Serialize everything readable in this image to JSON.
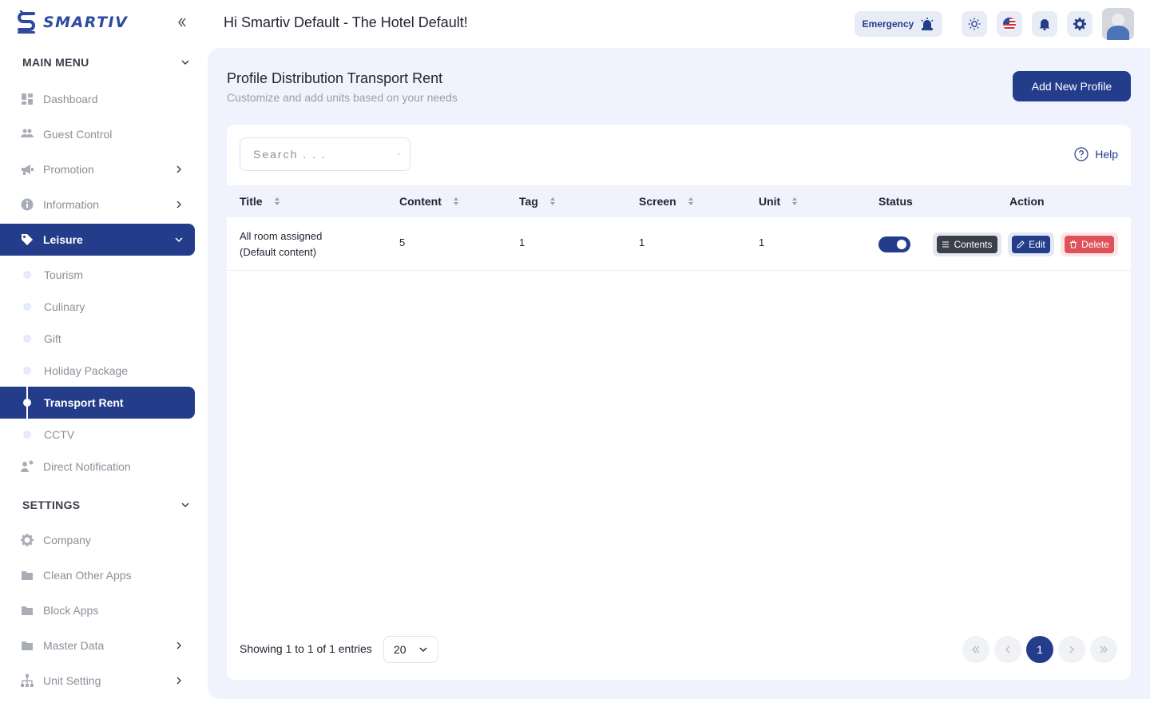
{
  "brand": {
    "name": "SMARTIV"
  },
  "header": {
    "greeting": "Hi Smartiv Default - The Hotel Default!",
    "emergency_label": "Emergency"
  },
  "sidebar": {
    "main_menu_label": "MAIN MENU",
    "items": [
      {
        "label": "Dashboard",
        "icon": "dashboard-icon"
      },
      {
        "label": "Guest Control",
        "icon": "users-icon"
      },
      {
        "label": "Promotion",
        "icon": "megaphone-icon"
      },
      {
        "label": "Information",
        "icon": "info-icon"
      },
      {
        "label": "Leisure",
        "icon": "tag-icon"
      }
    ],
    "leisure_sub": [
      "Tourism",
      "Culinary",
      "Gift",
      "Holiday Package",
      "Transport Rent",
      "CCTV"
    ],
    "direct_notification": "Direct Notification",
    "settings_label": "SETTINGS",
    "settings_items": [
      {
        "label": "Company",
        "icon": "gear-icon"
      },
      {
        "label": "Clean Other Apps",
        "icon": "folder-icon"
      },
      {
        "label": "Block Apps",
        "icon": "folder-icon"
      },
      {
        "label": "Master Data",
        "icon": "folder-icon"
      },
      {
        "label": "Unit Setting",
        "icon": "sitemap-icon"
      }
    ]
  },
  "page": {
    "title": "Profile Distribution Transport Rent",
    "subtitle": "Customize and add units based on your needs",
    "add_button": "Add New Profile",
    "search_placeholder": "Search . . .",
    "help_label": "Help"
  },
  "table": {
    "columns": [
      "Title",
      "Content",
      "Tag",
      "Screen",
      "Unit",
      "Status",
      "Action"
    ],
    "rows": [
      {
        "title_line1": "All room assigned",
        "title_line2": "(Default content)",
        "content": "5",
        "tag": "1",
        "screen": "1",
        "unit": "1",
        "status": true
      }
    ],
    "actions": {
      "contents": "Contents",
      "edit": "Edit",
      "delete": "Delete"
    }
  },
  "pagination": {
    "info": "Showing 1 to 1 of 1 entries",
    "per_page": "20",
    "current_page": "1"
  },
  "colors": {
    "primary": "#233d8b",
    "danger": "#e0525a",
    "dark": "#3a3f4b",
    "main_bg": "#f0f2fd"
  }
}
